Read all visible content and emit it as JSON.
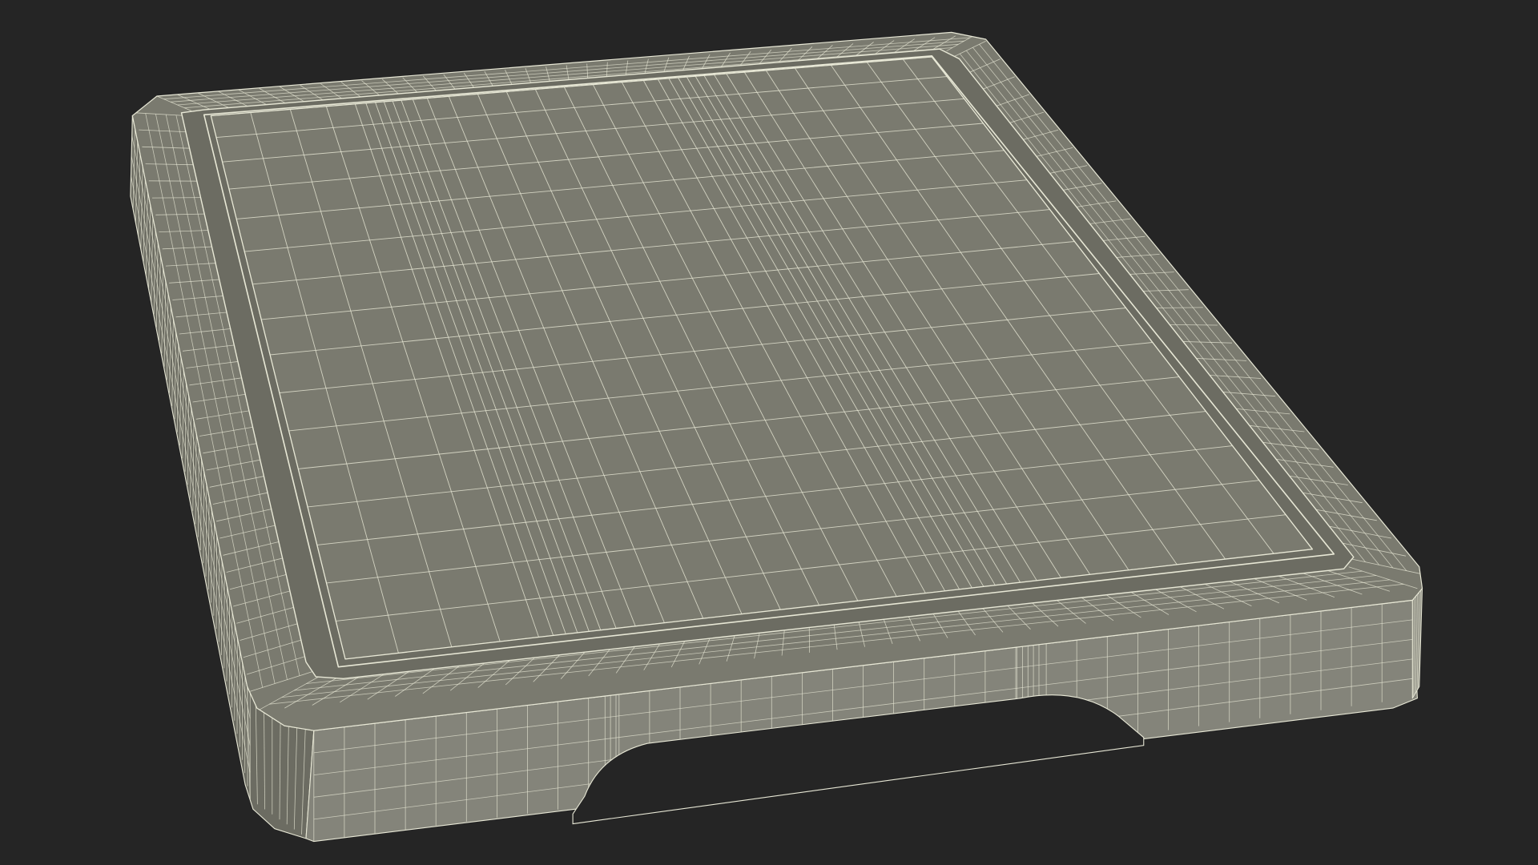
{
  "scene": {
    "subject": "cutting-board",
    "display_mode": "wireframe",
    "colors": {
      "background": "#252525",
      "surface": "#7a7a6f",
      "surface_shadow": "#6c6c62",
      "surface_light": "#84847a",
      "wire": "#e8e8d6"
    }
  }
}
